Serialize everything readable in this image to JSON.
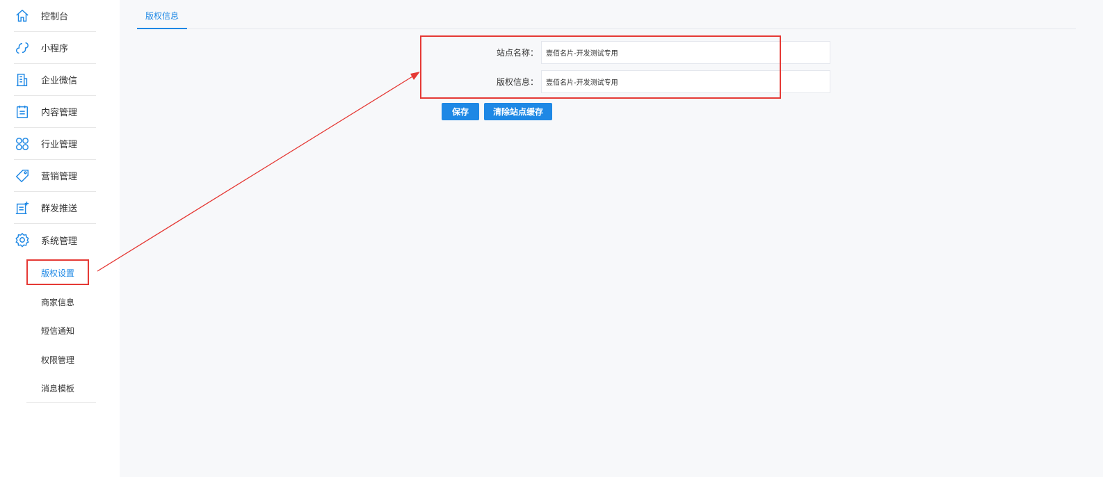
{
  "sidebar": {
    "items": [
      {
        "label": "控制台",
        "icon": "home-icon"
      },
      {
        "label": "小程序",
        "icon": "miniprogram-icon"
      },
      {
        "label": "企业微信",
        "icon": "building-icon"
      },
      {
        "label": "内容管理",
        "icon": "document-icon"
      },
      {
        "label": "行业管理",
        "icon": "industry-icon"
      },
      {
        "label": "营销管理",
        "icon": "tag-icon"
      },
      {
        "label": "群发推送",
        "icon": "push-icon"
      },
      {
        "label": "系统管理",
        "icon": "gear-icon"
      }
    ],
    "subitems": [
      {
        "label": "版权设置",
        "active": true
      },
      {
        "label": "商家信息",
        "active": false
      },
      {
        "label": "短信通知",
        "active": false
      },
      {
        "label": "权限管理",
        "active": false
      },
      {
        "label": "消息模板",
        "active": false
      }
    ]
  },
  "tabs": [
    {
      "label": "版权信息",
      "active": true
    }
  ],
  "form": {
    "site_name": {
      "label": "站点名称：",
      "value": "壹佰名片-开发测试专用"
    },
    "copyright": {
      "label": "版权信息：",
      "value": "壹佰名片-开发测试专用"
    }
  },
  "buttons": {
    "save": "保存",
    "clear_cache": "清除站点缓存"
  },
  "colors": {
    "accent": "#1e88e5",
    "annotation": "#e53935"
  }
}
